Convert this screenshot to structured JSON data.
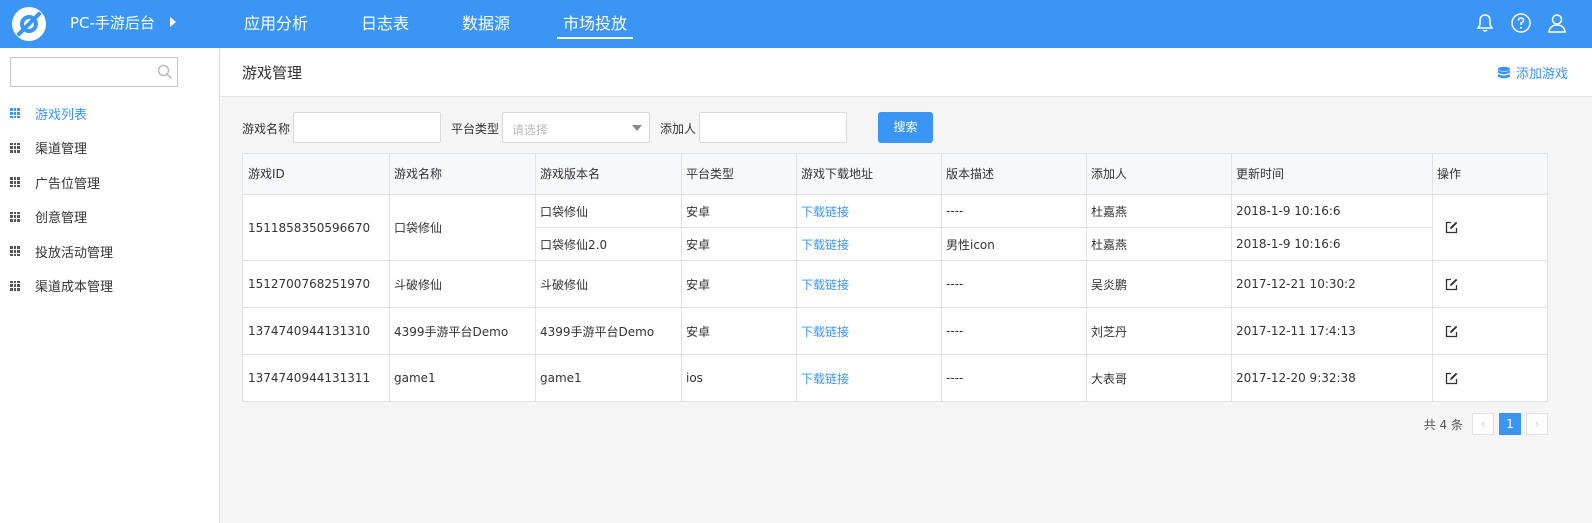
{
  "topbar": {
    "app_title": "PC-手游后台",
    "nav": [
      "应用分析",
      "日志表",
      "数据源",
      "市场投放"
    ],
    "active_nav_index": 3,
    "icons": [
      "bell-icon",
      "help-icon",
      "user-icon"
    ]
  },
  "sidebar": {
    "search": {
      "placeholder": ""
    },
    "items": [
      {
        "label": "游戏列表",
        "active": true
      },
      {
        "label": "渠道管理",
        "active": false
      },
      {
        "label": "广告位管理",
        "active": false
      },
      {
        "label": "创意管理",
        "active": false
      },
      {
        "label": "投放活动管理",
        "active": false
      },
      {
        "label": "渠道成本管理",
        "active": false
      }
    ]
  },
  "page": {
    "title": "游戏管理",
    "add_button": "添加游戏"
  },
  "filter": {
    "name_label": "游戏名称",
    "name_value": "",
    "platform_label": "平台类型",
    "platform_placeholder": "请选择",
    "adder_label": "添加人",
    "adder_value": "",
    "search_button": "搜索"
  },
  "table": {
    "headers": [
      "游戏ID",
      "游戏名称",
      "游戏版本名",
      "平台类型",
      "游戏下载地址",
      "版本描述",
      "添加人",
      "更新时间",
      "操作"
    ],
    "rows": [
      {
        "id": "1511858350596670",
        "name": "口袋修仙",
        "versions": [
          {
            "version_name": "口袋修仙",
            "platform": "安卓",
            "download": "下载链接",
            "desc": "----",
            "adder": "杜嘉燕",
            "updated": "2018-1-9 10:16:6"
          },
          {
            "version_name": "口袋修仙2.0",
            "platform": "安卓",
            "download": "下载链接",
            "desc": "男性icon",
            "adder": "杜嘉燕",
            "updated": "2018-1-9 10:16:6"
          }
        ]
      },
      {
        "id": "1512700768251970",
        "name": "斗破修仙",
        "versions": [
          {
            "version_name": "斗破修仙",
            "platform": "安卓",
            "download": "下载链接",
            "desc": "----",
            "adder": "吴炎鹏",
            "updated": "2017-12-21 10:30:2"
          }
        ]
      },
      {
        "id": "1374740944131310",
        "name": "4399手游平台Demo",
        "versions": [
          {
            "version_name": "4399手游平台Demo",
            "platform": "安卓",
            "download": "下载链接",
            "desc": "----",
            "adder": "刘芝丹",
            "updated": "2017-12-11 17:4:13"
          }
        ]
      },
      {
        "id": "1374740944131311",
        "name": "game1",
        "versions": [
          {
            "version_name": "game1",
            "platform": "ios",
            "download": "下载链接",
            "desc": "----",
            "adder": "大表哥",
            "updated": "2017-12-20 9:32:38"
          }
        ]
      }
    ]
  },
  "pagination": {
    "total": "共 4 条",
    "current": "1",
    "prev": "‹",
    "next": "›"
  },
  "colors": {
    "primary": "#3b95f5"
  }
}
